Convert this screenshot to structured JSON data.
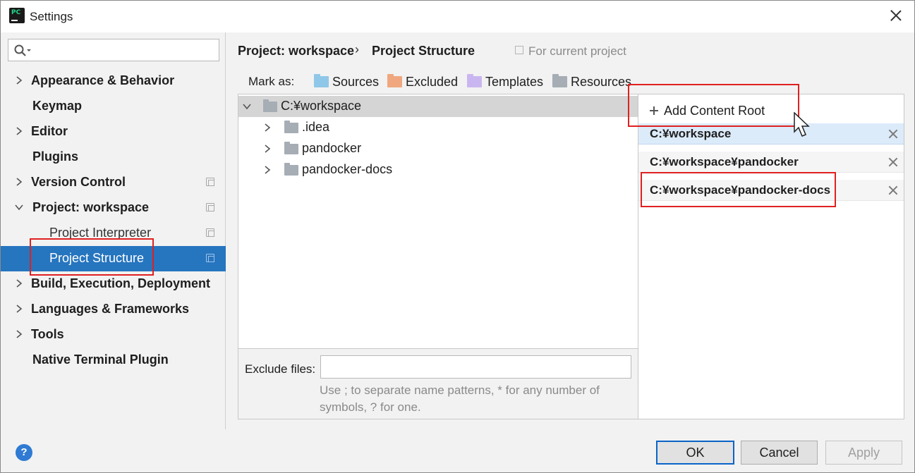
{
  "window": {
    "title": "Settings",
    "app_icon": "pycharm-icon"
  },
  "search": {
    "placeholder": "",
    "icon": "search-icon"
  },
  "sidebar": {
    "items": [
      {
        "label": "Appearance & Behavior",
        "expandable": true
      },
      {
        "label": "Keymap",
        "expandable": false
      },
      {
        "label": "Editor",
        "expandable": true
      },
      {
        "label": "Plugins",
        "expandable": false
      },
      {
        "label": "Version Control",
        "expandable": true,
        "project_icon": true
      },
      {
        "label": "Project: workspace",
        "expandable": true,
        "expanded": true,
        "project_icon": true
      },
      {
        "label": "Project Interpreter",
        "sub": true,
        "project_icon": true
      },
      {
        "label": "Project Structure",
        "sub": true,
        "selected": true,
        "project_icon": true
      },
      {
        "label": "Build, Execution, Deployment",
        "expandable": true
      },
      {
        "label": "Languages & Frameworks",
        "expandable": true
      },
      {
        "label": "Tools",
        "expandable": true
      },
      {
        "label": "Native Terminal Plugin",
        "expandable": false
      }
    ]
  },
  "breadcrumb": {
    "parent": "Project: workspace",
    "separator": "›",
    "current": "Project Structure",
    "scope": "For current project"
  },
  "mark_as": {
    "label": "Mark as:",
    "buttons": [
      {
        "label": "Sources",
        "color": "#8fc7e8"
      },
      {
        "label": "Excluded",
        "color": "#f0a77f"
      },
      {
        "label": "Templates",
        "color": "#c9b6f0"
      },
      {
        "label": "Resources",
        "color": "#a6adb4"
      }
    ]
  },
  "file_tree": {
    "root": "C:¥workspace",
    "children": [
      ".idea",
      "pandocker",
      "pandocker-docs"
    ]
  },
  "exclude": {
    "label": "Exclude files:",
    "value": "",
    "hint": "Use ; to separate name patterns, * for any number of symbols, ? for one."
  },
  "content_roots": {
    "add_label": "Add Content Root",
    "entries": [
      "C:¥workspace",
      "C:¥workspace¥pandocker",
      "C:¥workspace¥pandocker-docs"
    ]
  },
  "buttons": {
    "ok": "OK",
    "cancel": "Cancel",
    "apply": "Apply",
    "help": "?"
  },
  "colors": {
    "selection": "#2675bf",
    "highlight": "#e02020",
    "accent": "#0a64c8"
  }
}
